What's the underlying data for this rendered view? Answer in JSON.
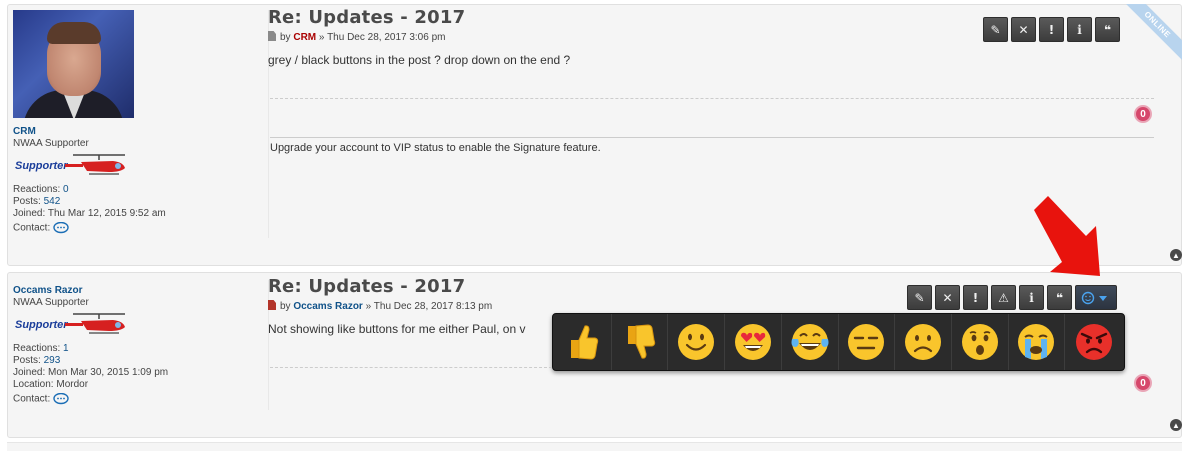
{
  "posts": [
    {
      "title": "Re: Updates - 2017",
      "by_label": "by",
      "author": "CRM",
      "date": "» Thu Dec 28, 2017 3:06 pm",
      "content": "grey / black buttons in the post ? drop down on the end ?",
      "signature": "Upgrade your account to VIP status to enable the Signature feature.",
      "reaction_count": "0",
      "online_label": "ONLINE",
      "profile": {
        "username": "CRM",
        "rank": "NWAA Supporter",
        "rank_badge": "Supporter",
        "reactions_label": "Reactions:",
        "reactions": "0",
        "posts_label": "Posts:",
        "posts": "542",
        "joined_label": "Joined:",
        "joined": "Thu Mar 12, 2015 9:52 am",
        "contact_label": "Contact:"
      }
    },
    {
      "title": "Re: Updates - 2017",
      "by_label": "by",
      "author": "Occams Razor",
      "date": "» Thu Dec 28, 2017 8:13 pm",
      "content": "Not showing like buttons for me either Paul, on v",
      "reaction_count": "0",
      "profile": {
        "username": "Occams Razor",
        "rank": "NWAA Supporter",
        "rank_badge": "Supporter",
        "reactions_label": "Reactions:",
        "reactions": "1",
        "posts_label": "Posts:",
        "posts": "293",
        "joined_label": "Joined:",
        "joined": "Mon Mar 30, 2015 1:09 pm",
        "location_label": "Location:",
        "location": "Mordor",
        "contact_label": "Contact:"
      }
    }
  ],
  "buttons": {
    "edit": "✎",
    "delete": "✕",
    "report": "!",
    "warn": "⚠",
    "info": "i",
    "quote": "❝"
  },
  "reactions": [
    "thumbs-up",
    "thumbs-down",
    "smile",
    "heart-eyes",
    "tears-of-joy",
    "expressionless",
    "frown",
    "surprised",
    "crying",
    "angry"
  ],
  "colors": {
    "username": "#105289",
    "author_red": "#aa0000",
    "badge": "#d6476b",
    "arrow": "#e8130d"
  }
}
